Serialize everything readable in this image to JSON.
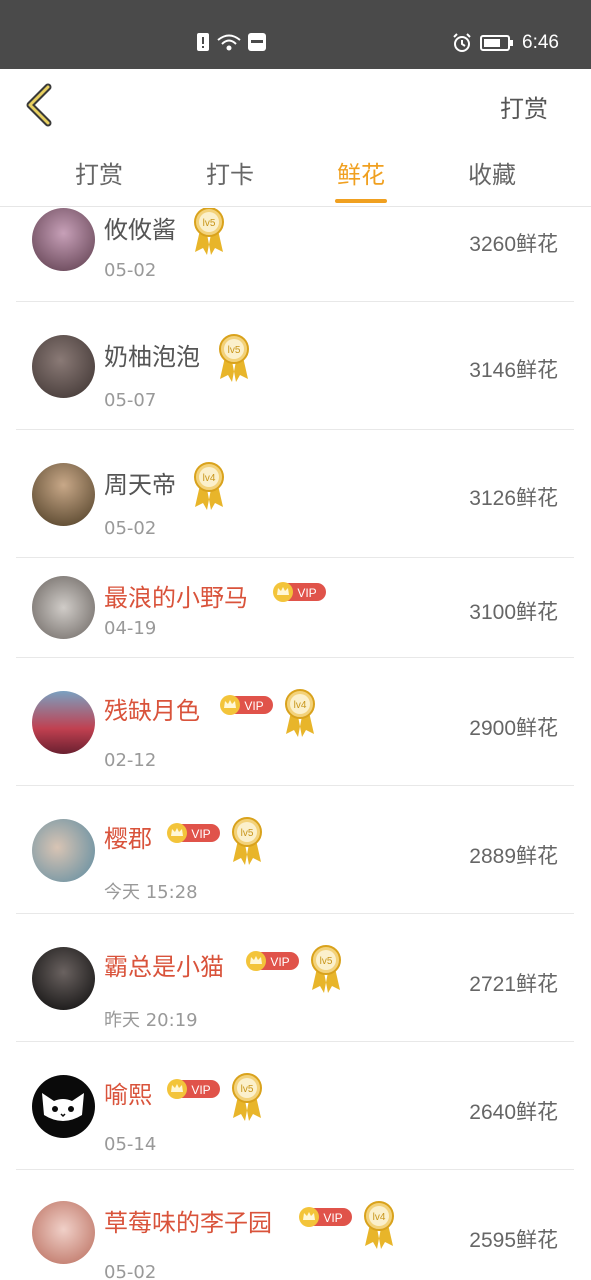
{
  "status_bar": {
    "time": "6:46"
  },
  "header": {
    "action_label": "打赏"
  },
  "tabs": [
    {
      "label": "打赏",
      "active": false
    },
    {
      "label": "打卡",
      "active": false
    },
    {
      "label": "鲜花",
      "active": true
    },
    {
      "label": "收藏",
      "active": false
    }
  ],
  "colors": {
    "accent": "#f0a020",
    "vip_name": "#d9533b",
    "vip_badge": "#e0534a",
    "medal": "#e8b52a"
  },
  "rows": [
    {
      "name": "攸攸酱",
      "date": "05-02",
      "amount": "3260鲜花",
      "vip": false,
      "level": "lv5",
      "vip_text": ""
    },
    {
      "name": "奶柚泡泡",
      "date": "05-07",
      "amount": "3146鲜花",
      "vip": false,
      "level": "lv5",
      "vip_text": ""
    },
    {
      "name": "周天帝",
      "date": "05-02",
      "amount": "3126鲜花",
      "vip": false,
      "level": "lv4",
      "vip_text": ""
    },
    {
      "name": "最浪的小野马",
      "date": "04-19",
      "amount": "3100鲜花",
      "vip": true,
      "level": "",
      "vip_text": "VIP"
    },
    {
      "name": "残缺月色",
      "date": "02-12",
      "amount": "2900鲜花",
      "vip": true,
      "level": "lv4",
      "vip_text": "VIP"
    },
    {
      "name": "樱郡",
      "date": "今天 15:28",
      "amount": "2889鲜花",
      "vip": true,
      "level": "lv5",
      "vip_text": "VIP"
    },
    {
      "name": "霸总是小猫",
      "date": "昨天 20:19",
      "amount": "2721鲜花",
      "vip": true,
      "level": "lv5",
      "vip_text": "VIP"
    },
    {
      "name": "喻熙",
      "date": "05-14",
      "amount": "2640鲜花",
      "vip": true,
      "level": "lv5",
      "vip_text": "VIP"
    },
    {
      "name": "草莓味的李子园",
      "date": "05-02",
      "amount": "2595鲜花",
      "vip": true,
      "level": "lv4",
      "vip_text": "VIP"
    }
  ]
}
